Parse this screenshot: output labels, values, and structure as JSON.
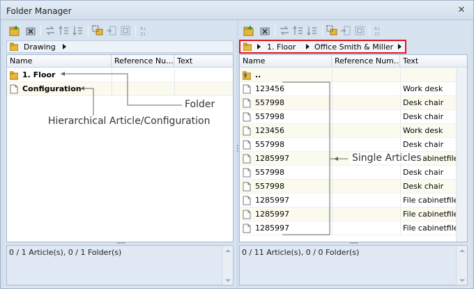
{
  "window": {
    "title": "Folder Manager"
  },
  "left": {
    "breadcrumb": [
      "Drawing"
    ],
    "columns": [
      "Name",
      "Reference Nu...",
      "Text"
    ],
    "rows": [
      {
        "name": "1. Floor",
        "type": "folder"
      },
      {
        "name": "Configuration",
        "type": "article"
      }
    ],
    "status": "0 / 1 Article(s), 0 / 1 Folder(s)"
  },
  "right": {
    "breadcrumb": [
      "1. Floor",
      "Office Smith & Miller"
    ],
    "columns": [
      "Name",
      "Reference Num...",
      "Text"
    ],
    "up_row": "..",
    "rows": [
      {
        "name": "123456",
        "text": "Work desk"
      },
      {
        "name": "557998",
        "text": "Desk chair"
      },
      {
        "name": "557998",
        "text": "Desk chair"
      },
      {
        "name": "123456",
        "text": "Work desk"
      },
      {
        "name": "557998",
        "text": "Desk chair"
      },
      {
        "name": "1285997",
        "text": "File cabinetfile ..."
      },
      {
        "name": "557998",
        "text": "Desk chair"
      },
      {
        "name": "557998",
        "text": "Desk chair"
      },
      {
        "name": "1285997",
        "text": "File cabinetfile ..."
      },
      {
        "name": "1285997",
        "text": "File cabinetfile ..."
      },
      {
        "name": "1285997",
        "text": "File cabinetfile ..."
      }
    ],
    "status": "0 / 11 Article(s), 0 / 0 Folder(s)"
  },
  "annotations": {
    "folder": "Folder",
    "hierarchical": "Hierarchical Article/Configuration",
    "single": "Single Articles"
  }
}
